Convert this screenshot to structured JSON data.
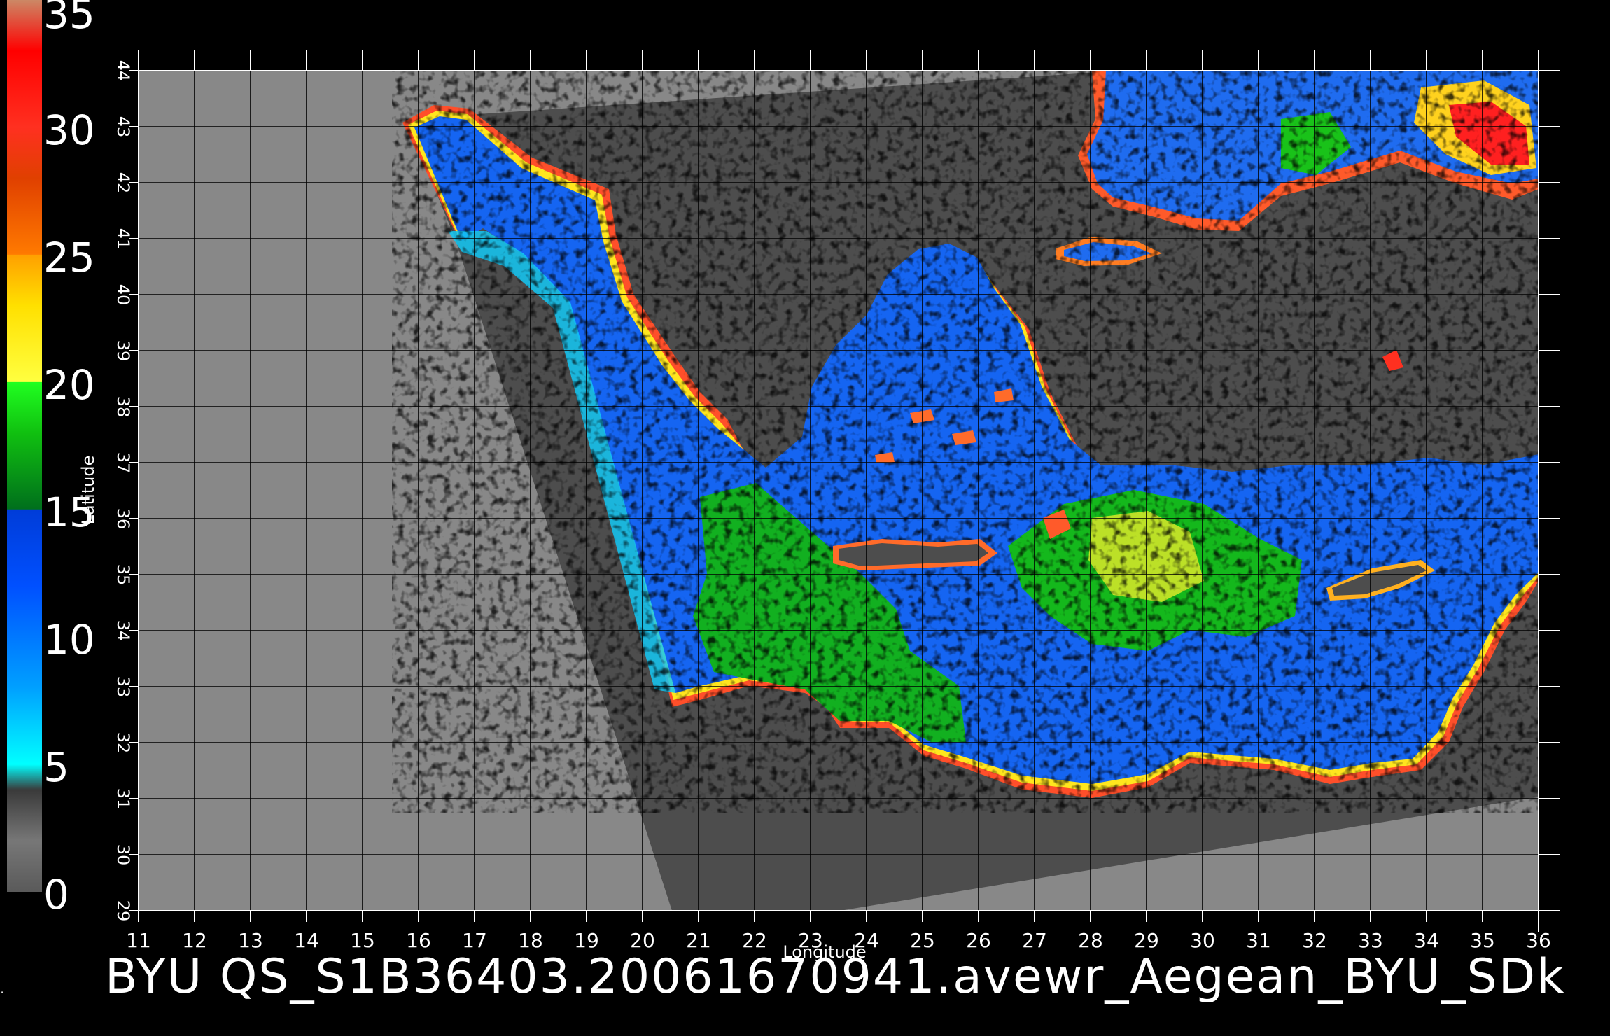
{
  "title": "BYU  QS_S1B36403.20061670941.avewr_Aegean_BYU_SDk",
  "colorbar": {
    "labels": [
      "0",
      "5",
      "10",
      "15",
      "20",
      "25",
      "30",
      "35"
    ],
    "stops": [
      {
        "v": 0,
        "c": "#5a5a5a"
      },
      {
        "v": 2,
        "c": "#777777"
      },
      {
        "v": 4,
        "c": "#3a3a3a"
      },
      {
        "v": 5,
        "c": "#00ffff"
      },
      {
        "v": 8,
        "c": "#00a0ff"
      },
      {
        "v": 12,
        "c": "#0050ff"
      },
      {
        "v": 15,
        "c": "#003cd8"
      },
      {
        "v": 15.01,
        "c": "#006f1c"
      },
      {
        "v": 18,
        "c": "#10c010"
      },
      {
        "v": 20,
        "c": "#20ff20"
      },
      {
        "v": 20.01,
        "c": "#ffff40"
      },
      {
        "v": 23,
        "c": "#ffe000"
      },
      {
        "v": 25,
        "c": "#ffa000"
      },
      {
        "v": 25.01,
        "c": "#ff7a00"
      },
      {
        "v": 28,
        "c": "#e04000"
      },
      {
        "v": 30,
        "c": "#ff3020"
      },
      {
        "v": 33,
        "c": "#ff0000"
      },
      {
        "v": 35,
        "c": "#cc8866"
      }
    ]
  },
  "axes": {
    "x_label": "Longitude",
    "y_label": "Latitude",
    "x_ticks": [
      "11",
      "12",
      "13",
      "14",
      "15",
      "16",
      "17",
      "18",
      "19",
      "20",
      "21",
      "22",
      "23",
      "24",
      "25",
      "26",
      "27",
      "28",
      "29",
      "30",
      "31",
      "32",
      "33",
      "34",
      "35",
      "36"
    ],
    "y_ticks": [
      "29",
      "30",
      "31",
      "32",
      "33",
      "34",
      "35",
      "36",
      "37",
      "38",
      "39",
      "40",
      "41",
      "42",
      "43",
      "44"
    ],
    "lon_range": [
      11,
      36
    ],
    "lat_range": [
      29,
      44
    ]
  },
  "colors": {
    "background": "#000000",
    "no_data": "#888888",
    "land": "#4d4d4d",
    "grid": "#000000"
  }
}
